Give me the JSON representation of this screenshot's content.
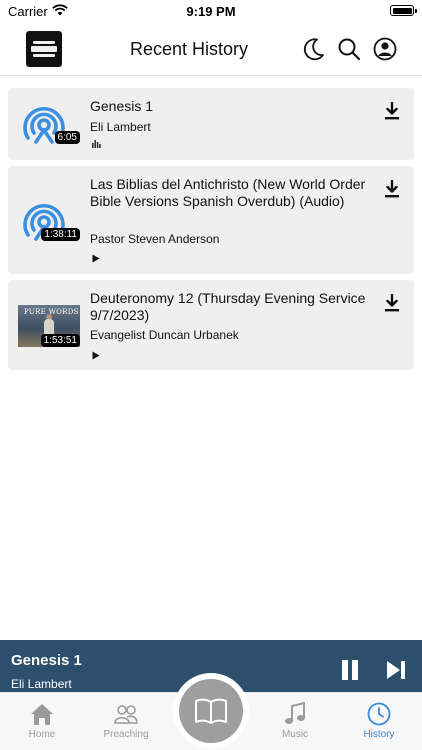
{
  "status_bar": {
    "carrier": "Carrier",
    "time": "9:19 PM"
  },
  "header": {
    "title": "Recent History",
    "icons": [
      "logo",
      "moon-icon",
      "search-icon",
      "profile-icon"
    ]
  },
  "history_items": [
    {
      "title": "Genesis 1",
      "author": "Eli Lambert",
      "duration": "6:05",
      "thumb": "broadcast-icon",
      "state": "now-playing-icon"
    },
    {
      "title": "Las Biblias del Antichristo (New World Order Bible Versions Spanish Overdub) (Audio)",
      "author": "Pastor Steven Anderson",
      "duration": "1:38:11",
      "thumb": "broadcast-icon",
      "state": "play-icon"
    },
    {
      "title": "Deuteronomy 12 (Thursday Evening Service 9/7/2023)",
      "author": "Evangelist Duncan Urbanek",
      "duration": "1:53:51",
      "thumb": "video-thumbnail",
      "thumb_text": "PURE WORDS",
      "state": "play-icon"
    }
  ],
  "now_playing": {
    "title": "Genesis 1",
    "author": "Eli Lambert"
  },
  "tabs": [
    {
      "label": "Home",
      "icon": "house-icon"
    },
    {
      "label": "Preaching",
      "icon": "people-icon"
    },
    {
      "label": "",
      "icon": "book-icon"
    },
    {
      "label": "Music",
      "icon": "music-note-icon"
    },
    {
      "label": "History",
      "icon": "clock-icon",
      "active": true
    }
  ],
  "colors": {
    "accent": "#3c88d8",
    "now_playing_bg": "#2c4f6e",
    "row_bg": "#efefef",
    "tab_inactive": "#9a9a9a"
  }
}
